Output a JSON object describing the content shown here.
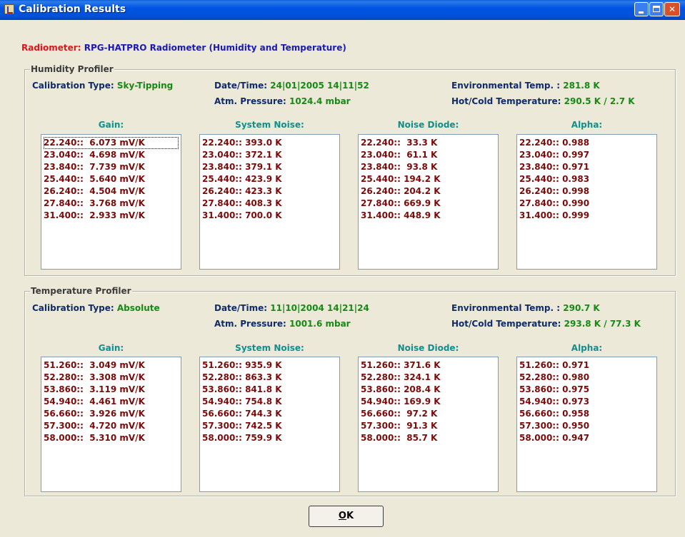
{
  "window": {
    "title": "Calibration Results"
  },
  "radiometer": {
    "label": "Radiometer:",
    "value": "RPG-HATPRO Radiometer (Humidity and Temperature)"
  },
  "profilers": [
    {
      "title": "Humidity Profiler",
      "calibration_type_label": "Calibration Type:",
      "calibration_type": "Sky-Tipping",
      "datetime_label": "Date/Time:",
      "datetime": "24|01|2005  14|11|52",
      "pressure_label": "Atm. Pressure:",
      "pressure": "1024.4 mbar",
      "env_temp_label": "Environmental Temp. :",
      "env_temp": "281.8 K",
      "hotcold_label": "Hot/Cold Temperature:",
      "hotcold": "290.5 K /   2.7 K",
      "columns": [
        {
          "header": "Gain:",
          "items": [
            "22.240::  6.073 mV/K",
            "23.040::  4.698 mV/K",
            "23.840::  7.739 mV/K",
            "25.440::  5.640 mV/K",
            "26.240::  4.504 mV/K",
            "27.840::  3.768 mV/K",
            "31.400::  2.933 mV/K"
          ]
        },
        {
          "header": "System Noise:",
          "items": [
            "22.240:: 393.0 K",
            "23.040:: 372.1 K",
            "23.840:: 379.1 K",
            "25.440:: 423.9 K",
            "26.240:: 423.3 K",
            "27.840:: 408.3 K",
            "31.400:: 700.0 K"
          ]
        },
        {
          "header": "Noise Diode:",
          "items": [
            "22.240::  33.3 K",
            "23.040::  61.1 K",
            "23.840::  93.8 K",
            "25.440:: 194.2 K",
            "26.240:: 204.2 K",
            "27.840:: 669.9 K",
            "31.400:: 448.9 K"
          ]
        },
        {
          "header": "Alpha:",
          "items": [
            "22.240:: 0.988",
            "23.040:: 0.997",
            "23.840:: 0.971",
            "25.440:: 0.983",
            "26.240:: 0.998",
            "27.840:: 0.990",
            "31.400:: 0.999"
          ]
        }
      ]
    },
    {
      "title": "Temperature Profiler",
      "calibration_type_label": "Calibration Type:",
      "calibration_type": "Absolute",
      "datetime_label": "Date/Time:",
      "datetime": "11|10|2004  14|21|24",
      "pressure_label": "Atm. Pressure:",
      "pressure": "1001.6 mbar",
      "env_temp_label": "Environmental Temp. :",
      "env_temp": "290.7 K",
      "hotcold_label": "Hot/Cold Temperature:",
      "hotcold": "293.8 K / 77.3 K",
      "columns": [
        {
          "header": "Gain:",
          "items": [
            "51.260::  3.049 mV/K",
            "52.280::  3.308 mV/K",
            "53.860::  3.119 mV/K",
            "54.940::  4.461 mV/K",
            "56.660::  3.926 mV/K",
            "57.300::  4.720 mV/K",
            "58.000::  5.310 mV/K"
          ]
        },
        {
          "header": "System Noise:",
          "items": [
            "51.260:: 935.9 K",
            "52.280:: 863.3 K",
            "53.860:: 841.8 K",
            "54.940:: 754.8 K",
            "56.660:: 744.3 K",
            "57.300:: 742.5 K",
            "58.000:: 759.9 K"
          ]
        },
        {
          "header": "Noise Diode:",
          "items": [
            "51.260:: 371.6 K",
            "52.280:: 324.1 K",
            "53.860:: 208.4 K",
            "54.940:: 169.9 K",
            "56.660::  97.2 K",
            "57.300::  91.3 K",
            "58.000::  85.7 K"
          ]
        },
        {
          "header": "Alpha:",
          "items": [
            "51.260:: 0.971",
            "52.280:: 0.980",
            "53.860:: 0.975",
            "54.940:: 0.973",
            "56.660:: 0.958",
            "57.300:: 0.950",
            "58.000:: 0.947"
          ]
        }
      ]
    }
  ],
  "ok_button": {
    "mnemonic": "O",
    "rest": "K"
  },
  "icons": {
    "app": "calibration-app-icon",
    "minimize": "minimize-icon",
    "maximize": "maximize-icon",
    "close": "close-icon"
  }
}
